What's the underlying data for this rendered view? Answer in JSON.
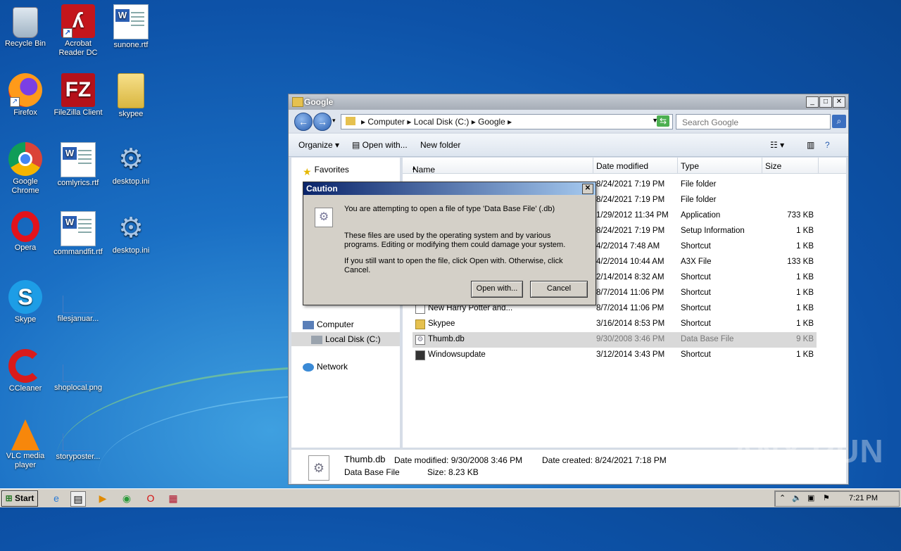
{
  "desktop": {
    "icons": [
      {
        "label": "Recycle Bin",
        "icon": "recycle-bin-icon"
      },
      {
        "label": "Acrobat Reader DC",
        "icon": "acrobat-icon"
      },
      {
        "label": "sunone.rtf",
        "icon": "word-document-icon"
      },
      {
        "label": "Firefox",
        "icon": "firefox-icon"
      },
      {
        "label": "FileZilla Client",
        "icon": "filezilla-icon"
      },
      {
        "label": "skypee",
        "icon": "folder-icon"
      },
      {
        "label": "Google Chrome",
        "icon": "chrome-icon"
      },
      {
        "label": "comlyrics.rtf",
        "icon": "word-document-icon"
      },
      {
        "label": "desktop.ini",
        "icon": "settings-file-icon"
      },
      {
        "label": "Opera",
        "icon": "opera-icon"
      },
      {
        "label": "commandfit.rtf",
        "icon": "word-document-icon"
      },
      {
        "label": "desktop.ini",
        "icon": "settings-file-icon"
      },
      {
        "label": "Skype",
        "icon": "skype-icon"
      },
      {
        "label": "filesjanuar...",
        "icon": "blank-file-icon"
      },
      {
        "label": "CCleaner",
        "icon": "ccleaner-icon"
      },
      {
        "label": "shoplocal.png",
        "icon": "blank-file-icon"
      },
      {
        "label": "VLC media player",
        "icon": "vlc-icon"
      },
      {
        "label": "storyposter...",
        "icon": "blank-file-icon"
      }
    ]
  },
  "explorer": {
    "title": "Google",
    "breadcrumb": [
      "Computer",
      "Local Disk (C:)",
      "Google"
    ],
    "search_placeholder": "Search Google",
    "toolbar": {
      "organize": "Organize",
      "open_with": "Open with...",
      "new_folder": "New folder"
    },
    "nav": {
      "favorites": "Favorites",
      "computer": "Computer",
      "local_disk": "Local Disk (C:)",
      "network": "Network"
    },
    "columns": {
      "name": "Name",
      "date": "Date modified",
      "type": "Type",
      "size": "Size"
    },
    "rows": [
      {
        "name": "",
        "date": "8/24/2021 7:19 PM",
        "type": "File folder",
        "size": ""
      },
      {
        "name": "",
        "date": "8/24/2021 7:19 PM",
        "type": "File folder",
        "size": ""
      },
      {
        "name": "",
        "date": "1/29/2012 11:34 PM",
        "type": "Application",
        "size": "733 KB"
      },
      {
        "name": "",
        "date": "8/24/2021 7:19 PM",
        "type": "Setup Information",
        "size": "1 KB"
      },
      {
        "name": "",
        "date": "4/2/2014 7:48 AM",
        "type": "Shortcut",
        "size": "1 KB"
      },
      {
        "name": "",
        "date": "4/2/2014 10:44 AM",
        "type": "A3X File",
        "size": "133 KB"
      },
      {
        "name": "",
        "date": "2/14/2014 8:32 AM",
        "type": "Shortcut",
        "size": "1 KB"
      },
      {
        "name": "",
        "date": "8/7/2014 11:06 PM",
        "type": "Shortcut",
        "size": "1 KB"
      },
      {
        "name": "New Harry Potter and...",
        "date": "8/7/2014 11:06 PM",
        "type": "Shortcut",
        "size": "1 KB"
      },
      {
        "name": "Skypee",
        "date": "3/16/2014 8:53 PM",
        "type": "Shortcut",
        "size": "1 KB"
      },
      {
        "name": "Thumb.db",
        "date": "9/30/2008 3:46 PM",
        "type": "Data Base File",
        "size": "9 KB"
      },
      {
        "name": "Windowsupdate",
        "date": "3/12/2014 3:43 PM",
        "type": "Shortcut",
        "size": "1 KB"
      }
    ],
    "details": {
      "filename": "Thumb.db",
      "filetype": "Data Base File",
      "modified": "Date modified: 9/30/2008 3:46 PM",
      "created": "Date created: 8/24/2021 7:18 PM",
      "size": "Size: 8.23 KB"
    }
  },
  "dialog": {
    "title": "Caution",
    "line1": "You are attempting to open a file of type 'Data Base File' (.db)",
    "line2": "These files are used by the operating system and by various programs. Editing or modifying them could damage your system.",
    "line3": "If you still want to open the file, click Open with. Otherwise, click Cancel.",
    "open_with": "Open with...",
    "cancel": "Cancel"
  },
  "taskbar": {
    "start": "Start",
    "clock": "7:21 PM"
  },
  "watermark": "ANY RUN"
}
